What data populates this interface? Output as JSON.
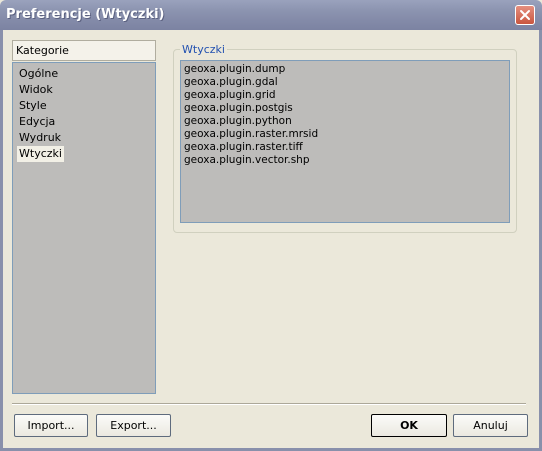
{
  "window": {
    "title": "Preferencje (Wtyczki)"
  },
  "sidebar": {
    "header": "Kategorie",
    "items": [
      {
        "label": "Ogólne"
      },
      {
        "label": "Widok"
      },
      {
        "label": "Style"
      },
      {
        "label": "Edycja"
      },
      {
        "label": "Wydruk"
      },
      {
        "label": "Wtyczki",
        "selected": true
      }
    ]
  },
  "plugins": {
    "group_title": "Wtyczki",
    "items": [
      "geoxa.plugin.dump",
      "geoxa.plugin.gdal",
      "geoxa.plugin.grid",
      "geoxa.plugin.postgis",
      "geoxa.plugin.python",
      "geoxa.plugin.raster.mrsid",
      "geoxa.plugin.raster.tiff",
      "geoxa.plugin.vector.shp"
    ]
  },
  "buttons": {
    "import": "Import...",
    "export": "Export...",
    "ok": "OK",
    "cancel": "Anuluj"
  },
  "colors": {
    "titlebar": "#8a91ad",
    "dialog_bg": "#ebe8da",
    "list_bg": "#bdbcba",
    "legend_text": "#2150b0"
  }
}
